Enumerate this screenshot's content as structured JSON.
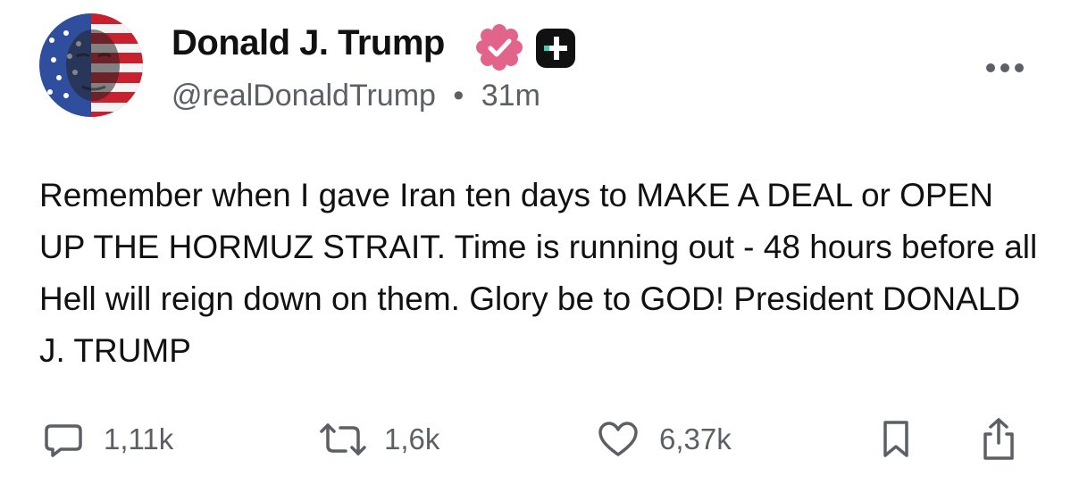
{
  "post": {
    "author_name": "Donald J. Trump",
    "handle": "@realDonaldTrump",
    "separator": "•",
    "time_ago": "31m",
    "text": "Remember when I gave Iran ten days to MAKE A DEAL or OPEN UP THE HORMUZ STRAIT. Time is running out - 48 hours before all Hell will reign down on them. Glory be to GOD! President DONALD J. TRUMP"
  },
  "icons": {
    "avatar": "avatar-image",
    "verified": "verified-badge-icon",
    "plus": "plus-badge-icon",
    "more": "more-options-icon",
    "reply": "reply-icon",
    "repost": "repost-icon",
    "like": "like-icon",
    "bookmark": "bookmark-icon",
    "share": "share-icon"
  },
  "actions": {
    "replies": "1,11k",
    "reposts": "1,6k",
    "likes": "6,37k"
  },
  "colors": {
    "verified_badge": "#e3648b",
    "plus_badge": "#111111",
    "plus_accent": "#3ed1b0",
    "secondary_text": "#5c5f66",
    "icon_stroke": "#5c5f66"
  }
}
